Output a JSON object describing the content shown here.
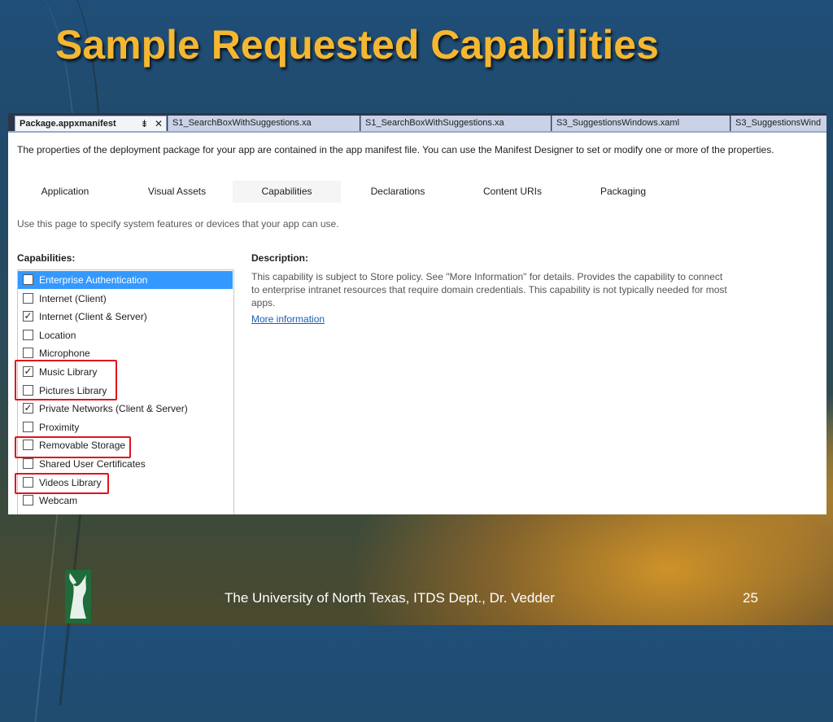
{
  "slide": {
    "title": "Sample Requested Capabilities",
    "footer": "The University of North Texas, ITDS Dept., Dr. Vedder",
    "page_number": "25"
  },
  "doc_tabs": [
    {
      "label": "Package.appxmanifest",
      "active": true
    },
    {
      "label": "S1_SearchBoxWithSuggestions.xa",
      "active": false
    },
    {
      "label": "S1_SearchBoxWithSuggestions.xa",
      "active": false
    },
    {
      "label": "S3_SuggestionsWindows.xaml",
      "active": false
    },
    {
      "label": "S3_SuggestionsWind",
      "active": false
    }
  ],
  "tab_icons": {
    "pin": "pin-icon",
    "close": "close-icon"
  },
  "intro_text": "The properties of the deployment package for your app are contained in the app manifest file. You can use the Manifest Designer to set or modify one or more of the properties.",
  "manifest_tabs": [
    {
      "label": "Application",
      "selected": false
    },
    {
      "label": "Visual Assets",
      "selected": false
    },
    {
      "label": "Capabilities",
      "selected": true
    },
    {
      "label": "Declarations",
      "selected": false
    },
    {
      "label": "Content URIs",
      "selected": false
    },
    {
      "label": "Packaging",
      "selected": false
    }
  ],
  "hint_text": "Use this page to specify system features or devices that your app can use.",
  "capabilities_heading": "Capabilities:",
  "capabilities": [
    {
      "label": "Enterprise Authentication",
      "checked": false,
      "selected": true,
      "highlighted": false
    },
    {
      "label": "Internet (Client)",
      "checked": false,
      "selected": false,
      "highlighted": false
    },
    {
      "label": "Internet (Client & Server)",
      "checked": true,
      "selected": false,
      "highlighted": false
    },
    {
      "label": "Location",
      "checked": false,
      "selected": false,
      "highlighted": false
    },
    {
      "label": "Microphone",
      "checked": false,
      "selected": false,
      "highlighted": false
    },
    {
      "label": "Music Library",
      "checked": true,
      "selected": false,
      "highlighted": true
    },
    {
      "label": "Pictures Library",
      "checked": false,
      "selected": false,
      "highlighted": true
    },
    {
      "label": "Private Networks (Client & Server)",
      "checked": true,
      "selected": false,
      "highlighted": false
    },
    {
      "label": "Proximity",
      "checked": false,
      "selected": false,
      "highlighted": false
    },
    {
      "label": "Removable Storage",
      "checked": false,
      "selected": false,
      "highlighted": true
    },
    {
      "label": "Shared User Certificates",
      "checked": false,
      "selected": false,
      "highlighted": false
    },
    {
      "label": "Videos Library",
      "checked": false,
      "selected": false,
      "highlighted": true
    },
    {
      "label": "Webcam",
      "checked": false,
      "selected": false,
      "highlighted": false
    }
  ],
  "description_heading": "Description:",
  "description_text": "This capability is subject to Store policy. See \"More Information\" for details. Provides the capability to connect to enterprise intranet resources that require domain credentials. This capability is not typically needed for most apps.",
  "more_info_link": "More information",
  "colors": {
    "title": "#f5b731",
    "highlight_box": "#e0141e",
    "selection": "#3399ff",
    "link": "#1a5fb4"
  },
  "logo_icon": "eagle-logo-icon"
}
